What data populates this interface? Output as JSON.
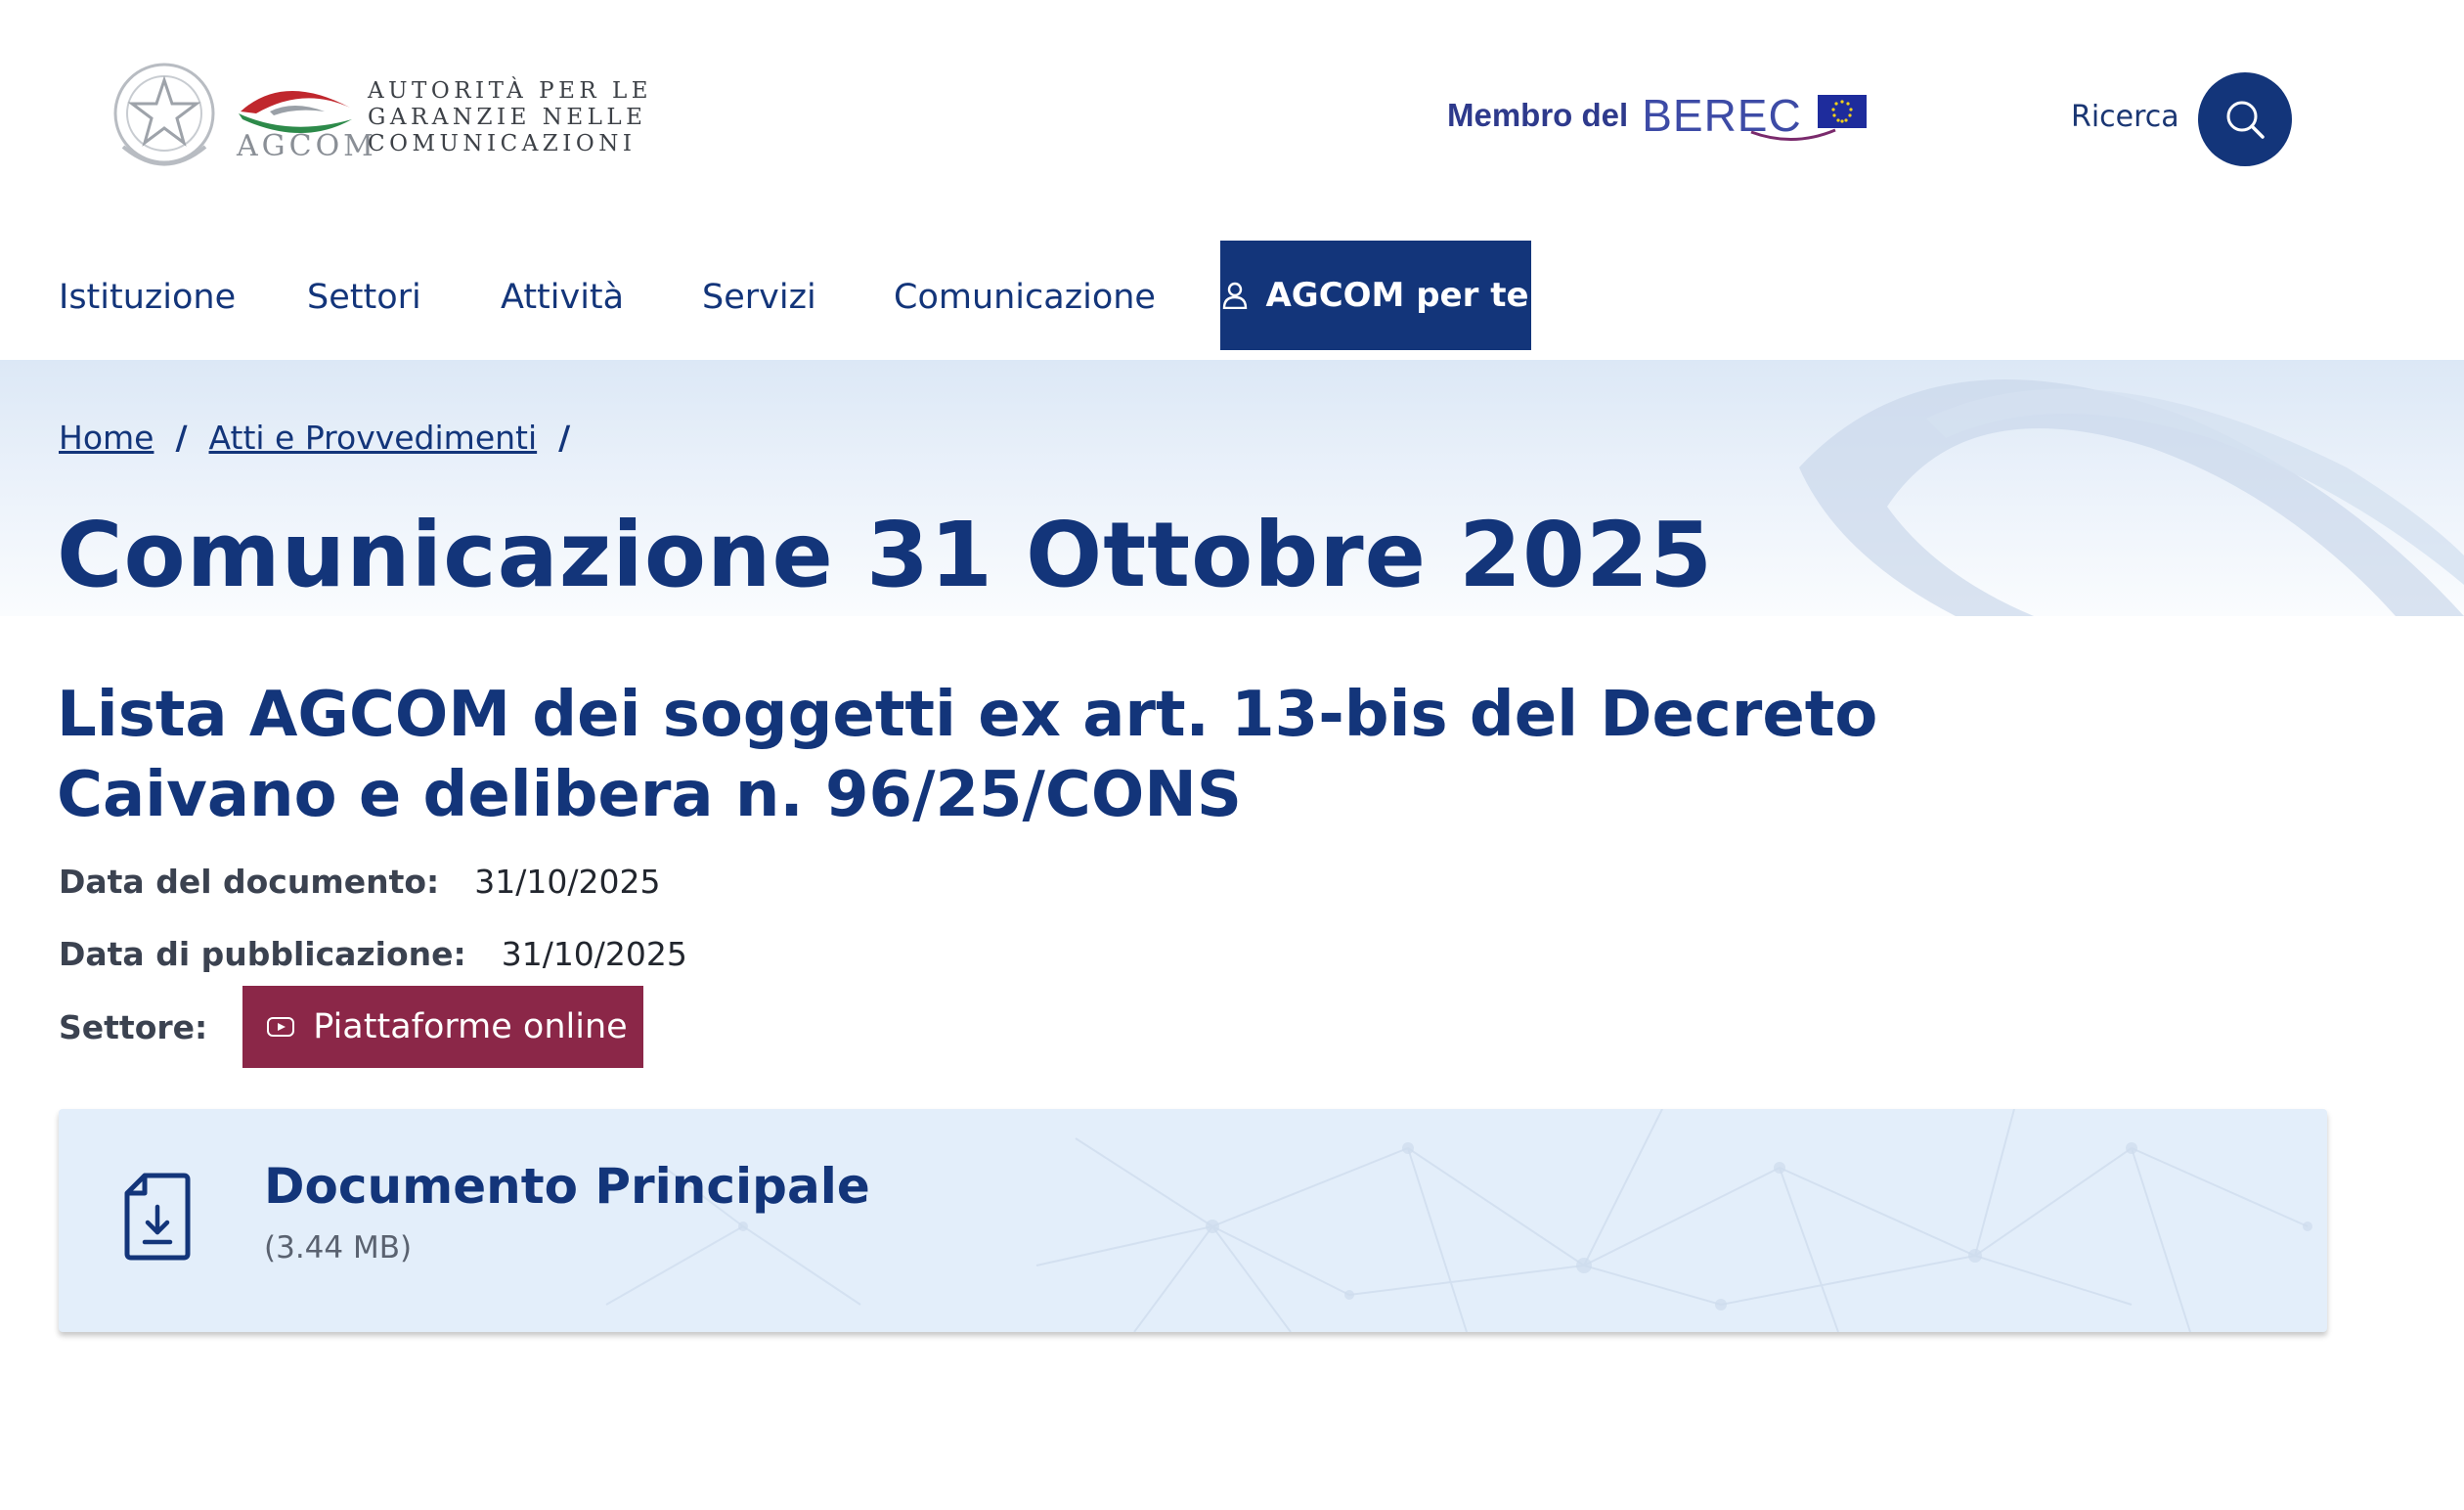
{
  "header": {
    "agcom_logo_word": "AGCOM",
    "agcom_lines": [
      "AUTORITÀ PER LE",
      "GARANZIE NELLE",
      "COMUNICAZIONI"
    ],
    "berec_prefix": "Membro del",
    "berec_name": "BEREC",
    "search_label": "Ricerca"
  },
  "nav": {
    "items": [
      {
        "label": "Istituzione"
      },
      {
        "label": "Settori"
      },
      {
        "label": "Attività"
      },
      {
        "label": "Servizi"
      },
      {
        "label": "Comunicazione"
      }
    ],
    "cta_label": "AGCOM per te"
  },
  "breadcrumb": {
    "items": [
      {
        "label": "Home"
      },
      {
        "label": "Atti e Provvedimenti"
      }
    ],
    "separator": "/"
  },
  "page": {
    "title": "Comunicazione 31 Ottobre 2025",
    "subtitle": "Lista AGCOM dei soggetti ex art. 13-bis del Decreto Caivano e delibera n. 96/25/CONS"
  },
  "meta": {
    "document_date_label": "Data del documento:",
    "document_date": "31/10/2025",
    "publication_date_label": "Data di pubblicazione:",
    "publication_date": "31/10/2025",
    "sector_label": "Settore:",
    "sector_value": "Piattaforme online"
  },
  "document": {
    "title": "Documento Principale",
    "size": "(3.44 MB)"
  },
  "colors": {
    "primary": "#13357a",
    "sector_badge": "#8b2748",
    "card_bg": "#e3eefa"
  },
  "icons": {
    "search": "search-icon",
    "user": "user-icon",
    "sector": "play-icon",
    "document": "file-download-icon"
  }
}
